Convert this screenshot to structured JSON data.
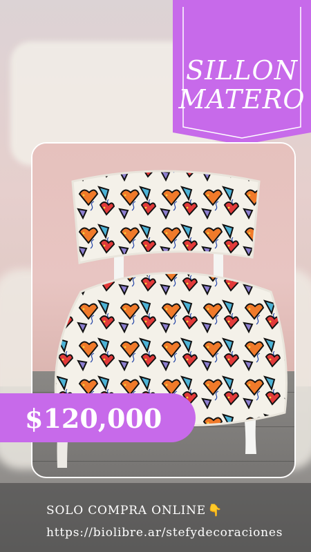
{
  "title": {
    "line1": "SILLON",
    "line2": "MATERO"
  },
  "price": "$120,000",
  "footer": {
    "line1": "SOLO COMPRA ONLINE",
    "line1_emoji": "👇",
    "line2": "https://biolibre.ar/stefydecoraciones"
  },
  "colors": {
    "accent": "#c76aea",
    "banner": "#c76aea",
    "text": "#ffffff"
  },
  "icons": {
    "pointing_down": "pointing-down-icon"
  }
}
